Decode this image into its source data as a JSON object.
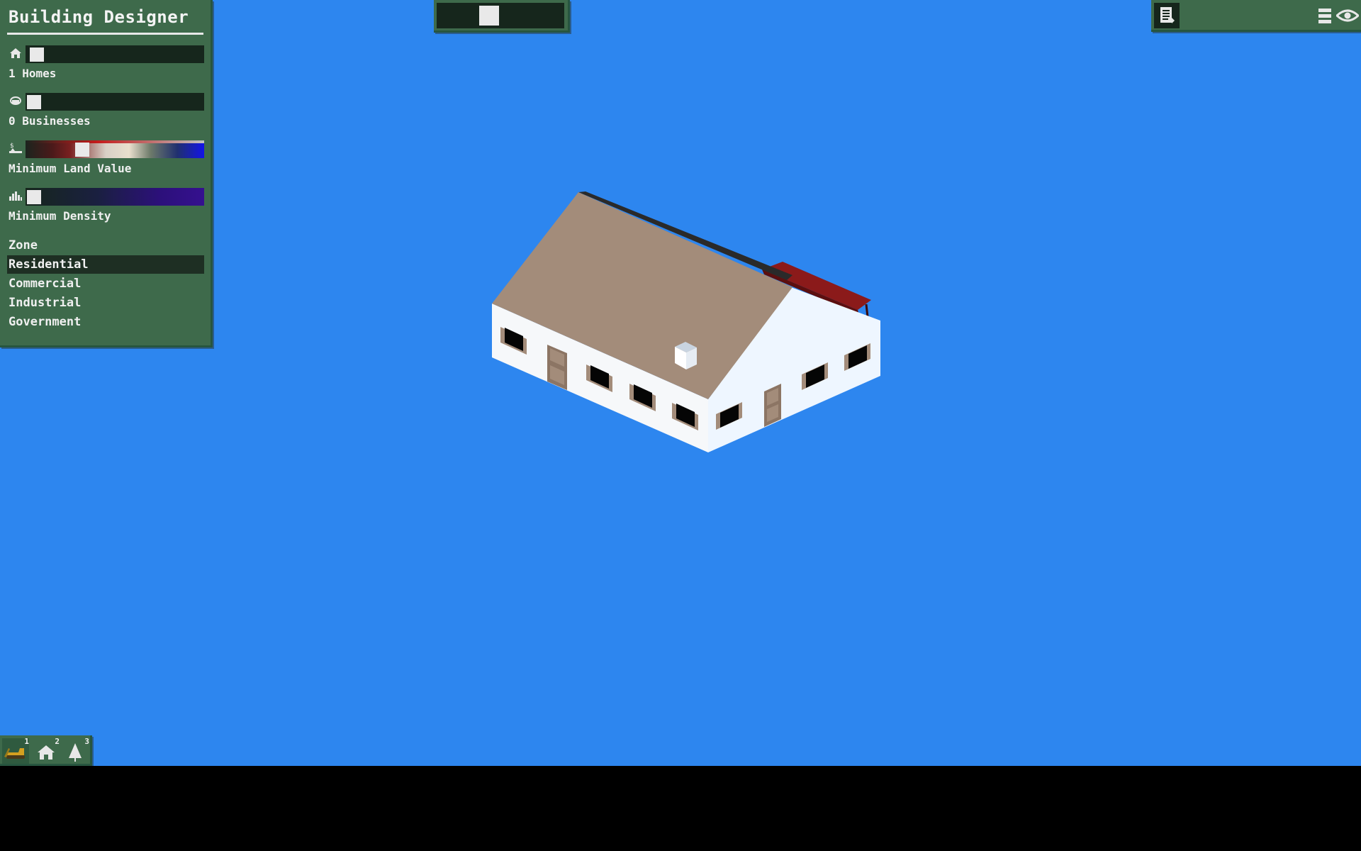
{
  "designer": {
    "title": "Building Designer",
    "homes": {
      "label": "1 Homes",
      "icon": "home-icon",
      "value": 1
    },
    "businesses": {
      "label": "0 Businesses",
      "icon": "briefcase-icon",
      "value": 0
    },
    "land_value": {
      "label": "Minimum Land Value",
      "icon": "land-value-icon",
      "fraction": 0.3
    },
    "density": {
      "label": "Minimum Density",
      "icon": "density-icon",
      "fraction": 0.0
    },
    "zone": {
      "heading": "Zone",
      "items": [
        "Residential",
        "Commercial",
        "Industrial",
        "Government"
      ],
      "selected": "Residential"
    }
  },
  "top_slider": {
    "fraction": 0.35
  },
  "top_right": {
    "icons": [
      "document-icon",
      "menu-icon",
      "eye-icon"
    ]
  },
  "tools": [
    {
      "icon": "bulldozer-icon",
      "hotkey": "1"
    },
    {
      "icon": "house-icon",
      "hotkey": "2"
    },
    {
      "icon": "tree-icon",
      "hotkey": "3"
    }
  ],
  "colors": {
    "sky": "#2d86ef",
    "panel": "#3e6a4b",
    "roof": "#a38c7a",
    "walls": "#ffffff",
    "awning": "#8b1a1a"
  }
}
